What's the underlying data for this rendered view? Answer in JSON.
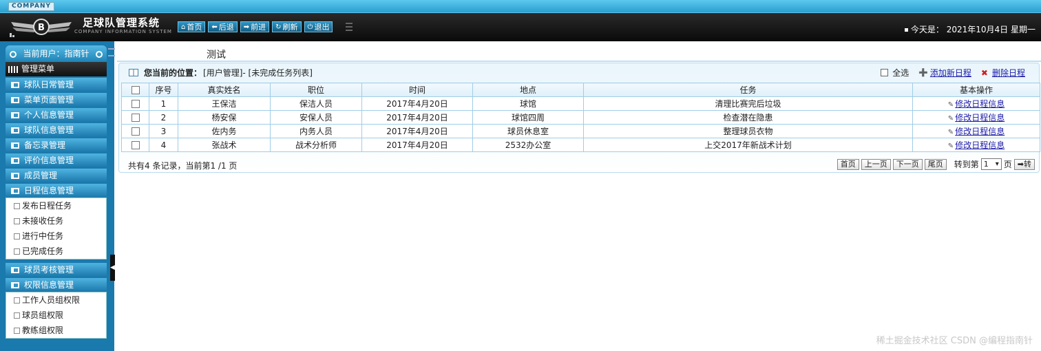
{
  "header": {
    "company": "COMPANY",
    "title": "足球队管理系统",
    "subtitle": "COMPANY INFORMATION SYSTEM",
    "toolbar": [
      {
        "icon": "home-icon",
        "glyph": "⌂",
        "label": "首页"
      },
      {
        "icon": "back-icon",
        "glyph": "⬅",
        "label": "后退"
      },
      {
        "icon": "forward-icon",
        "glyph": "➡",
        "label": "前进"
      },
      {
        "icon": "refresh-icon",
        "glyph": "↻",
        "label": "刷新"
      },
      {
        "icon": "power-icon",
        "glyph": "⏻",
        "label": "退出"
      }
    ],
    "date_prefix": "今天是：",
    "date": "2021年10月4日 星期一"
  },
  "sidebar": {
    "current_user": "当前用户：指南针",
    "menu_title": "管理菜单",
    "groups": [
      {
        "label": "球队日常管理"
      },
      {
        "label": "菜单页面管理"
      },
      {
        "label": "个人信息管理"
      },
      {
        "label": "球队信息管理"
      },
      {
        "label": "备忘录管理"
      },
      {
        "label": "评价信息管理"
      },
      {
        "label": "成员管理"
      },
      {
        "label": "日程信息管理"
      },
      {
        "label": "球员考核管理"
      },
      {
        "label": "权限信息管理"
      }
    ],
    "schedule_sub": [
      {
        "label": "发布日程任务"
      },
      {
        "label": "未接收任务"
      },
      {
        "label": "进行中任务"
      },
      {
        "label": "已完成任务"
      }
    ],
    "perm_sub": [
      {
        "label": "工作人员组权限"
      },
      {
        "label": "球员组权限"
      },
      {
        "label": "教练组权限"
      }
    ]
  },
  "main": {
    "page_title": "测试",
    "location_label": "您当前的位置：",
    "location_path": "[用户管理]- [未完成任务列表]",
    "select_all": "全选",
    "add_link": "添加新日程",
    "delete_link": "删除日程",
    "columns": [
      "",
      "序号",
      "真实姓名",
      "职位",
      "时间",
      "地点",
      "任务",
      "基本操作"
    ],
    "rows": [
      {
        "no": "1",
        "name": "王保洁",
        "position": "保洁人员",
        "time": "2017年4月20日",
        "place": "球馆",
        "task": "清理比赛完后垃圾",
        "action": "修改日程信息"
      },
      {
        "no": "2",
        "name": "杨安保",
        "position": "安保人员",
        "time": "2017年4月20日",
        "place": "球馆四周",
        "task": "检查潜在隐患",
        "action": "修改日程信息"
      },
      {
        "no": "3",
        "name": "佐内务",
        "position": "内务人员",
        "time": "2017年4月20日",
        "place": "球员休息室",
        "task": "整理球员衣物",
        "action": "修改日程信息"
      },
      {
        "no": "4",
        "name": "张战术",
        "position": "战术分析师",
        "time": "2017年4月20日",
        "place": "2532办公室",
        "task": "上交2017年新战术计划",
        "action": "修改日程信息"
      }
    ],
    "footer": "共有4 条记录，当前第1 /1 页",
    "pager": {
      "first": "首页",
      "prev": "上一页",
      "next": "下一页",
      "last": "尾页",
      "goto_label": "转到第",
      "page_value": "1",
      "page_unit": "页",
      "go_button": "➡转"
    }
  },
  "watermark": "稀土掘金技术社区 CSDN @编程指南针"
}
